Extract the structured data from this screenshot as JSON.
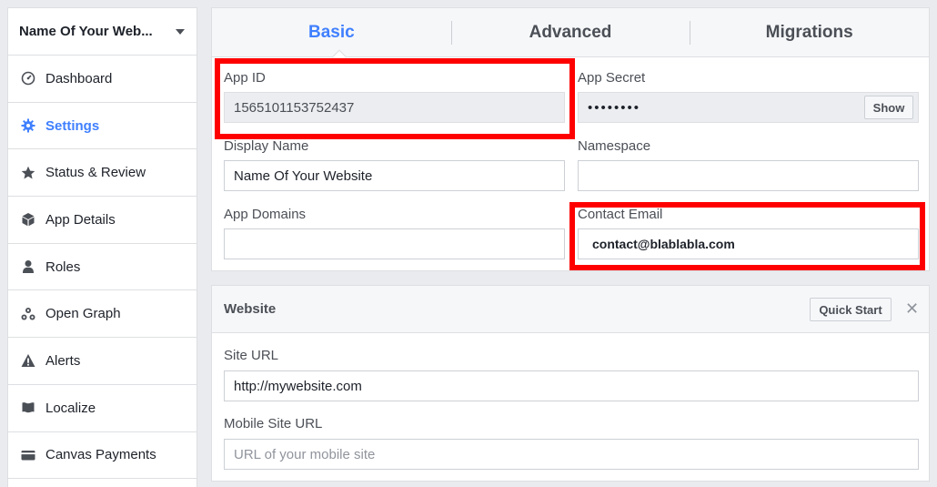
{
  "sidebar": {
    "app_name": "Name Of Your Web...",
    "items": [
      {
        "label": "Dashboard",
        "icon": "dashboard-icon"
      },
      {
        "label": "Settings",
        "icon": "gear-icon",
        "active": true
      },
      {
        "label": "Status & Review",
        "icon": "star-icon"
      },
      {
        "label": "App Details",
        "icon": "cube-icon"
      },
      {
        "label": "Roles",
        "icon": "person-icon"
      },
      {
        "label": "Open Graph",
        "icon": "open-graph-icon"
      },
      {
        "label": "Alerts",
        "icon": "warning-icon"
      },
      {
        "label": "Localize",
        "icon": "flag-icon"
      },
      {
        "label": "Canvas Payments",
        "icon": "credit-card-icon"
      }
    ]
  },
  "tabs": [
    "Basic",
    "Advanced",
    "Migrations"
  ],
  "active_tab": "Basic",
  "basic": {
    "app_id_label": "App ID",
    "app_id_value": "1565101153752437",
    "app_secret_label": "App Secret",
    "app_secret_value": "••••••••",
    "show_button": "Show",
    "display_name_label": "Display Name",
    "display_name_value": "Name Of Your Website",
    "namespace_label": "Namespace",
    "namespace_value": "",
    "app_domains_label": "App Domains",
    "app_domains_value": "",
    "contact_email_label": "Contact Email",
    "contact_email_value": "contact@blablabla.com"
  },
  "website": {
    "title": "Website",
    "quick_start_button": "Quick Start",
    "close_symbol": "✕",
    "site_url_label": "Site URL",
    "site_url_value": "http://mywebsite.com",
    "mobile_site_url_label": "Mobile Site URL",
    "mobile_site_url_placeholder": "URL of your mobile site"
  },
  "colors": {
    "accent": "#4080ff",
    "highlight": "#ff0000",
    "background": "#e9ebee"
  }
}
